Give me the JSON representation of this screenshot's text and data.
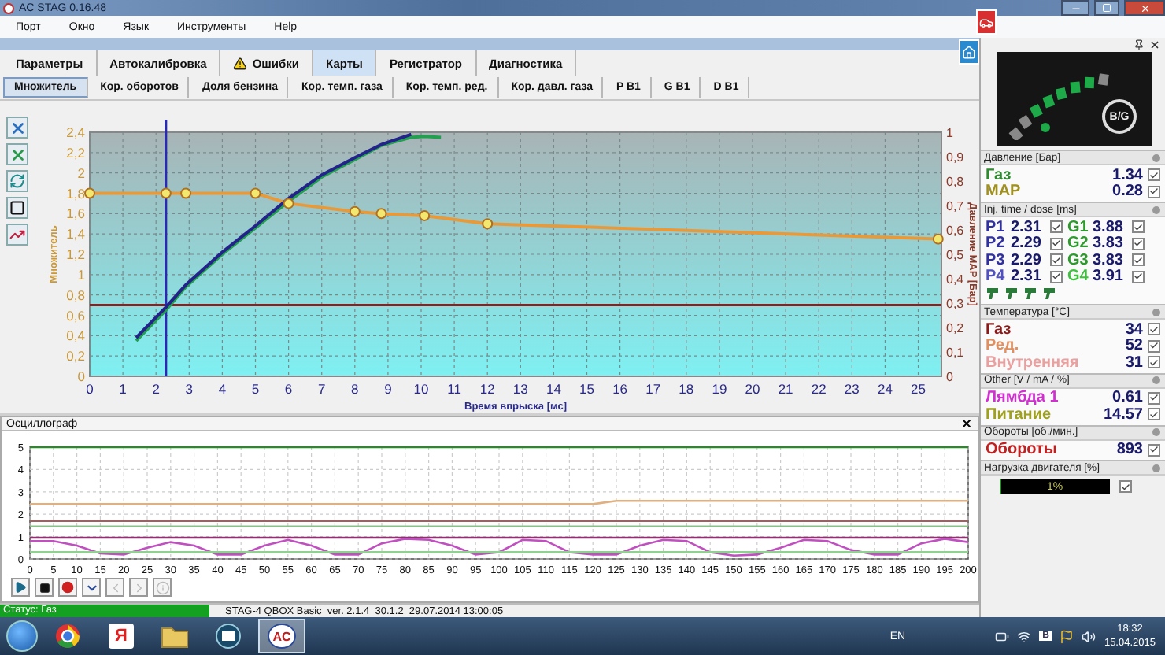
{
  "window": {
    "title": "AC STAG 0.16.48"
  },
  "menu": [
    "Порт",
    "Окно",
    "Язык",
    "Инструменты",
    "Help"
  ],
  "tabs": [
    {
      "label": "Параметры",
      "kind": "plain",
      "selected": false
    },
    {
      "label": "Автокалибровка",
      "kind": "plain",
      "selected": false
    },
    {
      "label": "Ошибки",
      "kind": "warning",
      "selected": false
    },
    {
      "label": "Карты",
      "kind": "plain",
      "selected": true
    },
    {
      "label": "Регистратор",
      "kind": "plain",
      "selected": false
    },
    {
      "label": "Диагностика",
      "kind": "plain",
      "selected": false
    }
  ],
  "subtabs": [
    {
      "label": "Множитель",
      "selected": true
    },
    {
      "label": "Кор. оборотов",
      "selected": false
    },
    {
      "label": "Доля бензина",
      "selected": false
    },
    {
      "label": "Кор. темп. газа",
      "selected": false
    },
    {
      "label": "Кор. темп. ред.",
      "selected": false
    },
    {
      "label": "Кор. давл. газа",
      "selected": false
    },
    {
      "label": "P B1",
      "selected": false
    },
    {
      "label": "G B1",
      "selected": false
    },
    {
      "label": "D B1",
      "selected": false
    }
  ],
  "map_chart": {
    "chart_data": {
      "type": "line",
      "xlabel": "Время впрыска [мс]",
      "ylabel": "Множитель",
      "y2label": "Давление MAP [Бар]",
      "x": [
        0,
        1.4,
        2.3,
        2.9,
        4,
        5,
        6,
        7,
        8,
        8.8,
        9.7,
        10.1,
        10.6,
        12,
        25.6
      ],
      "xlim": [
        0,
        25.7
      ],
      "ylim": [
        0,
        2.4
      ],
      "y2lim": [
        0,
        1
      ],
      "grid": true,
      "xticks": [
        0,
        1,
        2,
        3,
        4,
        5,
        6,
        7,
        8,
        9,
        10,
        11,
        12,
        13,
        14,
        15,
        16,
        17,
        18,
        19,
        20,
        21,
        22,
        23,
        24,
        25
      ],
      "yticks": [
        0,
        {
          "value": 0.2,
          "label": "0,2"
        },
        {
          "value": 0.4,
          "label": "0,4"
        },
        {
          "value": 0.6,
          "label": "0,6"
        },
        {
          "value": 0.8,
          "label": "0,8"
        },
        1,
        {
          "value": 1.2,
          "label": "1,2"
        },
        {
          "value": 1.4,
          "label": "1,4"
        },
        {
          "value": 1.6,
          "label": "1,6"
        },
        {
          "value": 1.8,
          "label": "1,8"
        },
        2,
        {
          "value": 2.2,
          "label": "2,2"
        },
        {
          "value": 2.4,
          "label": "2,4"
        }
      ],
      "y2ticks": [
        0,
        {
          "value": 0.1,
          "label": "0,1"
        },
        {
          "value": 0.2,
          "label": "0,2"
        },
        {
          "value": 0.3,
          "label": "0,3"
        },
        {
          "value": 0.4,
          "label": "0,4"
        },
        {
          "value": 0.5,
          "label": "0,5"
        },
        {
          "value": 0.6,
          "label": "0,6"
        },
        {
          "value": 0.7,
          "label": "0,7"
        },
        {
          "value": 0.8,
          "label": "0,8"
        },
        {
          "value": 0.9,
          "label": "0,9"
        },
        1
      ],
      "series": [
        {
          "color": "#e89a3a",
          "marker": "circle",
          "values": [
            1.8,
            null,
            1.8,
            1.8,
            null,
            1.8,
            1.7,
            null,
            1.62,
            1.6,
            null,
            1.58,
            null,
            1.5,
            1.35
          ]
        },
        {
          "color": "#22a050",
          "values": [
            null,
            0.35,
            0.65,
            0.88,
            1.2,
            1.46,
            1.72,
            1.96,
            2.13,
            2.27,
            2.35,
            2.36,
            2.35,
            null,
            null
          ]
        },
        {
          "color": "#23238a",
          "values": [
            null,
            0.38,
            0.68,
            0.9,
            1.22,
            1.48,
            1.75,
            1.98,
            2.15,
            2.28,
            2.38,
            null,
            null,
            null,
            null
          ]
        }
      ],
      "ref_lines": [
        {
          "axis": "y",
          "value": 0.7,
          "color": "#8b2020"
        },
        {
          "axis": "x",
          "value": 2.3,
          "color": "#2a2ab0"
        }
      ]
    }
  },
  "oscillograph": {
    "title": "Осциллограф",
    "chart_data": {
      "type": "line",
      "x": [
        0,
        5,
        10,
        15,
        20,
        25,
        30,
        35,
        40,
        45,
        50,
        55,
        60,
        65,
        70,
        75,
        80,
        85,
        90,
        95,
        100,
        105,
        110,
        115,
        120,
        125,
        130,
        135,
        140,
        145,
        150,
        155,
        160,
        165,
        170,
        175,
        180,
        185,
        190,
        195,
        200
      ],
      "xlim": [
        0,
        200
      ],
      "ylim": [
        0,
        5
      ],
      "grid": true,
      "xticks": [
        0,
        5,
        10,
        15,
        20,
        25,
        30,
        35,
        40,
        45,
        50,
        55,
        60,
        65,
        70,
        75,
        80,
        85,
        90,
        95,
        100,
        105,
        110,
        115,
        120,
        125,
        130,
        135,
        140,
        145,
        150,
        155,
        160,
        165,
        170,
        175,
        180,
        185,
        190,
        195,
        200
      ],
      "yticks": [
        0,
        1,
        2,
        3,
        4,
        5
      ],
      "series": [
        {
          "color": "#2a8a2a",
          "values": [
            5,
            5,
            5,
            5,
            5,
            5,
            5,
            5,
            5,
            5,
            5,
            5,
            5,
            5,
            5,
            5,
            5,
            5,
            5,
            5,
            5,
            5,
            5,
            5,
            5,
            5,
            5,
            5,
            5,
            5,
            5,
            5,
            5,
            5,
            5,
            5,
            5,
            5,
            5,
            5,
            5
          ]
        },
        {
          "color": "#e0b080",
          "values": [
            2.45,
            2.45,
            2.45,
            2.45,
            2.45,
            2.45,
            2.45,
            2.45,
            2.45,
            2.45,
            2.45,
            2.45,
            2.45,
            2.45,
            2.45,
            2.45,
            2.45,
            2.45,
            2.45,
            2.45,
            2.45,
            2.45,
            2.45,
            2.45,
            2.45,
            2.6,
            2.6,
            2.6,
            2.6,
            2.6,
            2.6,
            2.6,
            2.6,
            2.6,
            2.6,
            2.6,
            2.6,
            2.6,
            2.6,
            2.6,
            2.6
          ]
        },
        {
          "color": "#a06060",
          "values": [
            1.7,
            1.7,
            1.7,
            1.7,
            1.7,
            1.7,
            1.7,
            1.7,
            1.7,
            1.7,
            1.7,
            1.7,
            1.7,
            1.7,
            1.7,
            1.7,
            1.7,
            1.7,
            1.7,
            1.7,
            1.7,
            1.7,
            1.7,
            1.7,
            1.7,
            1.7,
            1.7,
            1.7,
            1.7,
            1.7,
            1.7,
            1.7,
            1.7,
            1.7,
            1.7,
            1.7,
            1.7,
            1.7,
            1.7,
            1.7,
            1.7
          ]
        },
        {
          "color": "#8ac08a",
          "values": [
            1.45,
            1.45,
            1.45,
            1.45,
            1.45,
            1.45,
            1.45,
            1.45,
            1.45,
            1.45,
            1.45,
            1.45,
            1.45,
            1.45,
            1.45,
            1.45,
            1.45,
            1.45,
            1.45,
            1.45,
            1.45,
            1.45,
            1.45,
            1.45,
            1.45,
            1.45,
            1.45,
            1.45,
            1.45,
            1.45,
            1.45,
            1.45,
            1.45,
            1.45,
            1.45,
            1.45,
            1.45,
            1.45,
            1.45,
            1.45,
            1.45
          ]
        },
        {
          "color": "#903070",
          "values": [
            0.95,
            0.95,
            0.95,
            0.95,
            0.95,
            0.95,
            0.95,
            0.95,
            0.95,
            0.95,
            0.95,
            0.95,
            0.95,
            0.95,
            0.95,
            0.95,
            0.95,
            0.95,
            0.95,
            0.95,
            0.95,
            0.95,
            0.95,
            0.95,
            0.95,
            0.95,
            0.95,
            0.95,
            0.95,
            0.95,
            0.95,
            0.95,
            0.95,
            0.95,
            0.95,
            0.95,
            0.95,
            0.95,
            0.95,
            0.95,
            0.95
          ]
        },
        {
          "color": "#c050c0",
          "values": [
            0.8,
            0.8,
            0.6,
            0.25,
            0.2,
            0.5,
            0.75,
            0.6,
            0.2,
            0.2,
            0.6,
            0.85,
            0.6,
            0.2,
            0.2,
            0.7,
            0.9,
            0.85,
            0.6,
            0.2,
            0.3,
            0.85,
            0.8,
            0.3,
            0.2,
            0.2,
            0.6,
            0.85,
            0.8,
            0.3,
            0.15,
            0.2,
            0.5,
            0.85,
            0.8,
            0.4,
            0.2,
            0.2,
            0.7,
            0.9,
            0.75
          ]
        },
        {
          "color": "#90d090",
          "values": [
            0.3,
            0.3,
            0.3,
            0.3,
            0.3,
            0.3,
            0.3,
            0.3,
            0.3,
            0.3,
            0.3,
            0.3,
            0.3,
            0.3,
            0.3,
            0.3,
            0.3,
            0.3,
            0.3,
            0.3,
            0.3,
            0.3,
            0.3,
            0.3,
            0.3,
            0.3,
            0.3,
            0.3,
            0.3,
            0.3,
            0.3,
            0.3,
            0.3,
            0.3,
            0.3,
            0.3,
            0.3,
            0.3,
            0.3,
            0.3,
            0.3
          ]
        }
      ]
    }
  },
  "status_bar": {
    "status": "Статус: Газ",
    "info": "STAG-4 QBOX Basic  ver. 2.1.4  30.1.2  29.07.2014 13:00:05"
  },
  "side_panel": {
    "gauge_label": "B/G",
    "sections": [
      {
        "title": "Давление [Бар]",
        "kind": "values",
        "rows": [
          {
            "label": "Газ",
            "value": "1.34",
            "color": "#2e8a2e",
            "checked": true
          },
          {
            "label": "MAP",
            "value": "0.28",
            "color": "#a09020",
            "checked": true
          }
        ]
      },
      {
        "title": "Inj. time / dose [ms]",
        "kind": "injectors",
        "rows": [
          {
            "cells": [
              {
                "label": "P1",
                "value": "2.31",
                "color": "#3030a0",
                "checked": true
              },
              {
                "label": "G1",
                "value": "3.88",
                "color": "#2e9a2e",
                "checked": true
              }
            ]
          },
          {
            "cells": [
              {
                "label": "P2",
                "value": "2.29",
                "color": "#3030a0",
                "checked": true
              },
              {
                "label": "G2",
                "value": "3.83",
                "color": "#2e9a2e",
                "checked": true
              }
            ]
          },
          {
            "cells": [
              {
                "label": "P3",
                "value": "2.29",
                "color": "#3030a0",
                "checked": true
              },
              {
                "label": "G3",
                "value": "3.83",
                "color": "#2e9a2e",
                "checked": true
              }
            ]
          },
          {
            "cells": [
              {
                "label": "P4",
                "value": "2.31",
                "color": "#5050c0",
                "checked": true
              },
              {
                "label": "G4",
                "value": "3.91",
                "color": "#40c040",
                "checked": true
              }
            ]
          }
        ]
      },
      {
        "title": "Температура [°C]",
        "kind": "values",
        "rows": [
          {
            "label": "Газ",
            "value": "34",
            "color": "#8a1a1a",
            "checked": true
          },
          {
            "label": "Ред.",
            "value": "52",
            "color": "#e09060",
            "checked": true
          },
          {
            "label": "Внутренняя",
            "value": "31",
            "color": "#e8a0a0",
            "checked": true
          }
        ]
      },
      {
        "title": "Other [V / mA / %]",
        "kind": "values",
        "rows": [
          {
            "label": "Лямбда 1",
            "value": "0.61",
            "color": "#d030d0",
            "checked": true
          },
          {
            "label": "Питание",
            "value": "14.57",
            "color": "#a0a020",
            "checked": true
          }
        ]
      },
      {
        "title": "Обороты [об./мин.]",
        "kind": "values",
        "rows": [
          {
            "label": "Обороты",
            "value": "893",
            "color": "#c02020",
            "checked": true
          }
        ]
      },
      {
        "title": "Нагрузка двигателя [%]",
        "kind": "load",
        "reading": "1%",
        "level": 0.01,
        "checked": true
      }
    ]
  },
  "taskbar": {
    "apps": [
      {
        "kind": "browser",
        "selected": false
      },
      {
        "kind": "yandex",
        "label": "Я",
        "selected": false
      },
      {
        "kind": "folder",
        "selected": false
      },
      {
        "kind": "media",
        "selected": false
      },
      {
        "kind": "stag",
        "label": "AC",
        "selected": true
      }
    ],
    "tray": [
      {
        "kind": "battery"
      },
      {
        "kind": "network"
      },
      {
        "kind": "badge",
        "label": "B"
      },
      {
        "kind": "flag"
      },
      {
        "kind": "volume"
      }
    ],
    "language": "EN",
    "time": "18:32",
    "date": "15.04.2015"
  }
}
